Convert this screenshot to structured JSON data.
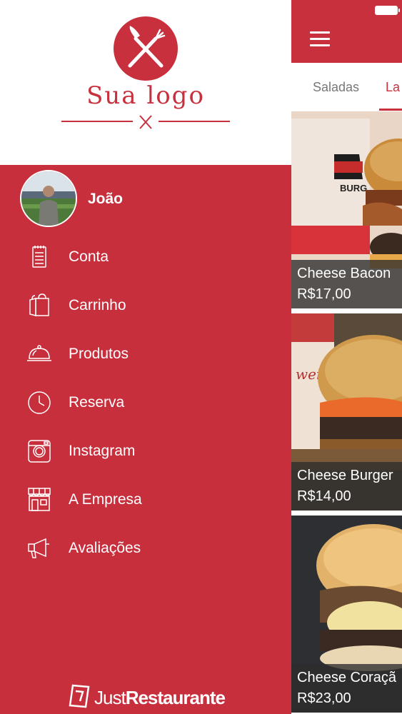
{
  "colors": {
    "brand_red": "#c72f3d",
    "text_white": "#ffffff",
    "tab_grey": "#777777"
  },
  "logo": {
    "text": "Sua logo",
    "icon": "fork-knife-icon"
  },
  "user": {
    "name": "João",
    "avatar": "avatar-photo"
  },
  "menu": [
    {
      "label": "Conta",
      "icon": "notepad-icon"
    },
    {
      "label": "Carrinho",
      "icon": "shopping-bag-icon"
    },
    {
      "label": "Produtos",
      "icon": "cloche-icon"
    },
    {
      "label": "Reserva",
      "icon": "clock-icon"
    },
    {
      "label": "Instagram",
      "icon": "instagram-icon"
    },
    {
      "label": "A Empresa",
      "icon": "storefront-icon"
    },
    {
      "label": "Avaliações",
      "icon": "megaphone-icon"
    }
  ],
  "footer": {
    "brand_light": "Just",
    "brand_bold": "Restaurante"
  },
  "app": {
    "tabs": [
      {
        "label": "Saladas"
      },
      {
        "label": "La"
      }
    ],
    "products": [
      {
        "name": "Cheese Bacon",
        "price": "R$17,00"
      },
      {
        "name": "Cheese Burger",
        "price": "R$14,00"
      },
      {
        "name": "Cheese Coraçã",
        "price": "R$23,00"
      }
    ],
    "burger_box_text": "BURG"
  }
}
